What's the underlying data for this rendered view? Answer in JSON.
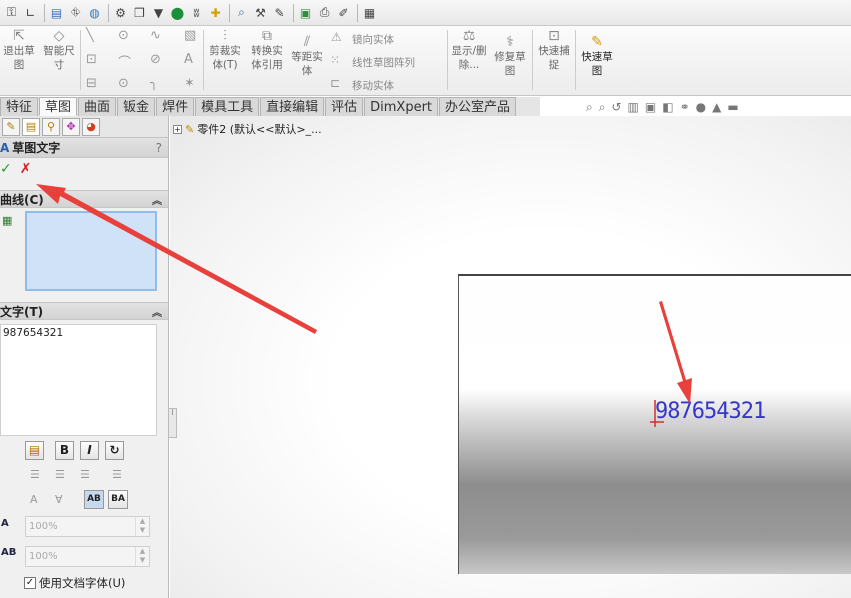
{
  "ribbon": {
    "exit_sketch": "退出草图",
    "smart_dim": "智能尺寸",
    "trim": "剪裁实体(T)",
    "convert": "转换实体引用",
    "offset": "等距实体",
    "mirror": "镜向实体",
    "linear_pattern": "线性草图阵列",
    "move": "移动实体",
    "display_delete": "显示/删除...",
    "repair": "修复草图",
    "quick_snap": "快速捕捉",
    "rapid_sketch": "快速草图"
  },
  "tabs": [
    "特征",
    "草图",
    "曲面",
    "钣金",
    "焊件",
    "模具工具",
    "直接编辑",
    "评估",
    "DimXpert",
    "办公室产品"
  ],
  "active_tab": "草图",
  "panel": {
    "title": "草图文字",
    "help": "?",
    "curves_header": "曲线(C)",
    "text_header": "文字(T)",
    "text_value": "987654321",
    "bold": "B",
    "italic": "I",
    "width_factor": "100%",
    "spacing": "100%",
    "use_doc_font": "使用文档字体(U)"
  },
  "tree": {
    "label": "零件2 (默认<<默认>_..."
  },
  "canvas": {
    "sketch_text": "987654321"
  },
  "colors": {
    "sketch_text": "#3636c8",
    "arrow": "#e8403a",
    "selection_box": "#cfe2f7"
  }
}
